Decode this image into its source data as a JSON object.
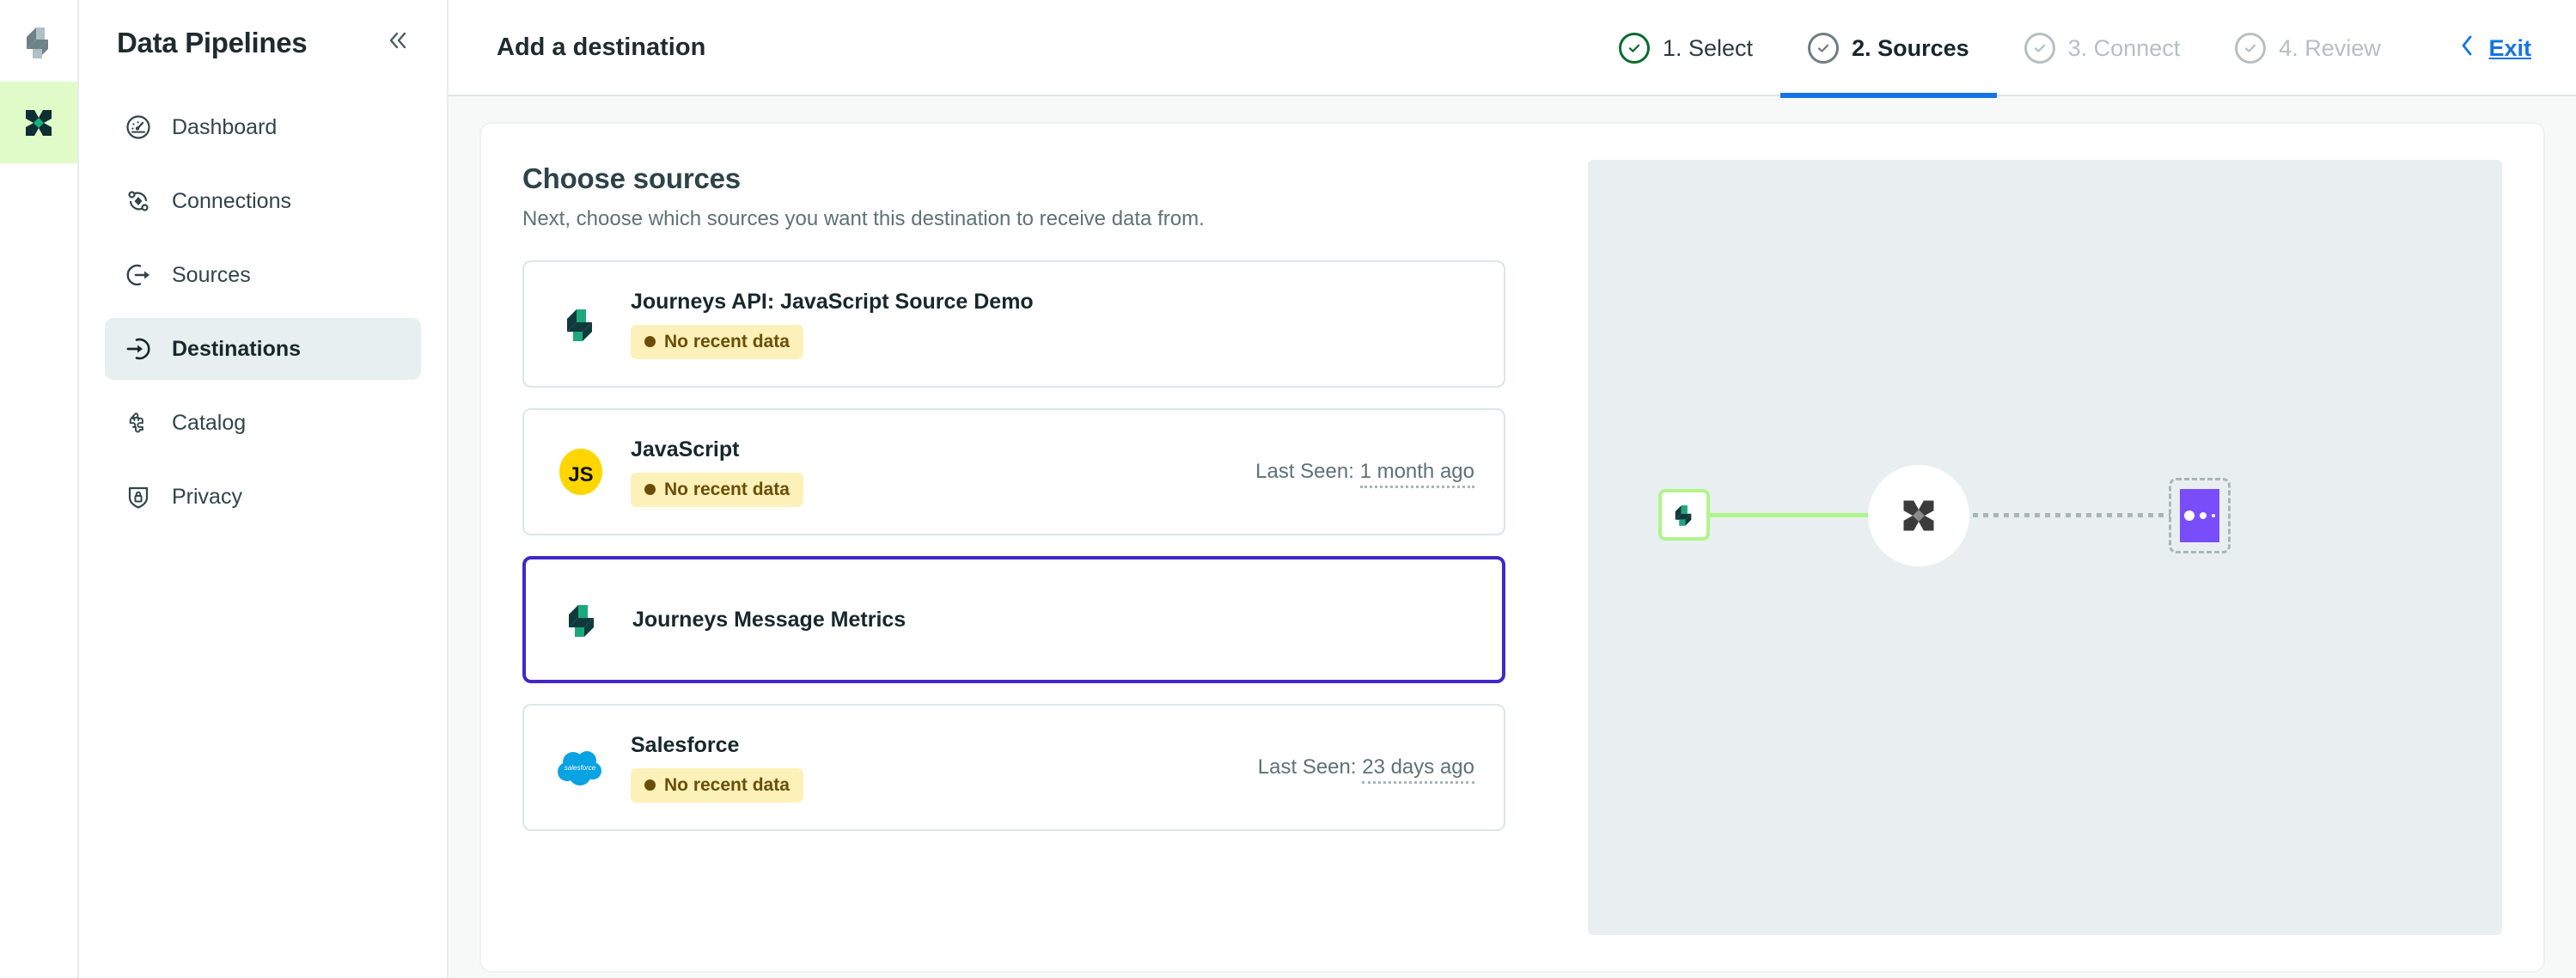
{
  "rail": {
    "brand_icon": "journeys-logo-icon",
    "items": [
      {
        "icon": "x-mark-icon",
        "name": "data-pipelines-product",
        "active": true
      }
    ]
  },
  "sidebar": {
    "title": "Data Pipelines",
    "collapse_icon": "chevron-double-left-icon",
    "collapse_label": "«",
    "items": [
      {
        "label": "Dashboard",
        "icon": "gauge-icon",
        "active": false
      },
      {
        "label": "Connections",
        "icon": "connections-icon",
        "active": false
      },
      {
        "label": "Sources",
        "icon": "source-arrow-icon",
        "active": false
      },
      {
        "label": "Destinations",
        "icon": "destination-arrow-icon",
        "active": true
      },
      {
        "label": "Catalog",
        "icon": "puzzle-icon",
        "active": false
      },
      {
        "label": "Privacy",
        "icon": "shield-lock-icon",
        "active": false
      }
    ]
  },
  "topbar": {
    "title": "Add a destination",
    "steps": [
      {
        "label": "1. Select",
        "state": "done"
      },
      {
        "label": "2. Sources",
        "state": "current"
      },
      {
        "label": "3. Connect",
        "state": "upcoming"
      },
      {
        "label": "4. Review",
        "state": "upcoming"
      }
    ],
    "exit": {
      "label": "Exit",
      "icon": "chevron-left-icon"
    }
  },
  "main": {
    "heading": "Choose sources",
    "subheading": "Next, choose which sources you want this destination to receive data from.",
    "sources": [
      {
        "name": "Journeys API: JavaScript Source Demo",
        "logo": "journeys-logo-icon",
        "status": "No recent data",
        "last_seen": "",
        "selected": false
      },
      {
        "name": "JavaScript",
        "logo": "javascript-js-icon",
        "status": "No recent data",
        "last_seen_label": "Last Seen:",
        "last_seen": "1 month ago",
        "selected": false
      },
      {
        "name": "Journeys Message Metrics",
        "logo": "journeys-logo-icon",
        "status": "",
        "last_seen": "",
        "selected": true
      },
      {
        "name": "Salesforce",
        "logo": "salesforce-cloud-icon",
        "status": "No recent data",
        "last_seen_label": "Last Seen:",
        "last_seen": "23 days ago",
        "selected": false
      }
    ]
  },
  "diagram": {
    "source_node_icon": "journeys-logo-icon",
    "hub_icon": "x-mark-icon",
    "destination_node_icon": "destination-placeholder-icon"
  },
  "colors": {
    "accent_blue": "#1574e5",
    "selected_purple": "#4327c7",
    "rail_active_green": "#e0fbc8",
    "edge_green": "#b0f58a",
    "badge_bg": "#fcf1b8",
    "badge_text": "#6b4d08",
    "destination_purple": "#7a4dfb",
    "step_done_green": "#0c6b2e"
  }
}
